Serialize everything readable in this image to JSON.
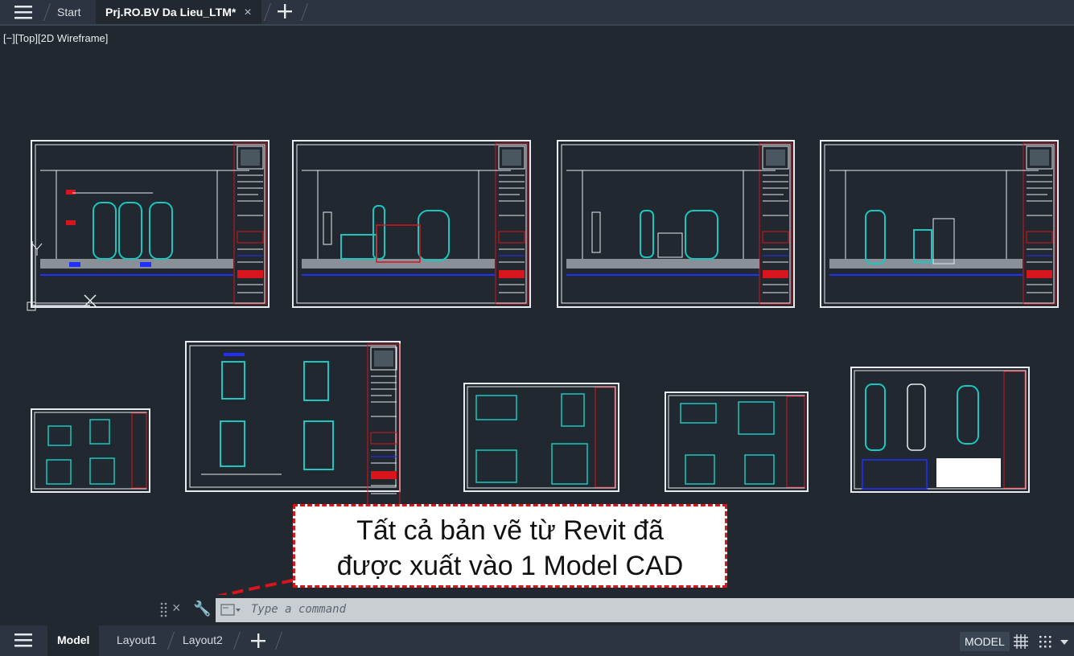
{
  "tabs": [
    {
      "label": "Start",
      "close": ""
    },
    {
      "label": "Prj.RO.BV Da Lieu_LTM*",
      "close": "×"
    }
  ],
  "viewport_label": "[−][Top][2D Wireframe]",
  "callout": {
    "line1": "Tất cả bản vẽ từ Revit đã",
    "line2": "được xuất vào 1 Model CAD"
  },
  "command": {
    "close_glyph": "×",
    "wrench_glyph": "🔧",
    "placeholder": "Type a command"
  },
  "layout_tabs": [
    "Model",
    "Layout1",
    "Layout2"
  ],
  "status": {
    "model_label": "MODEL"
  },
  "icons": [
    "menu-icon",
    "close-icon",
    "plus-icon",
    "ucs-icon",
    "grip-icon",
    "wrench-icon",
    "command-prompt-icon",
    "grid-icon",
    "snap-icon",
    "chevron-down-icon"
  ],
  "colors": {
    "canvas": "#212830",
    "sheet_border": "#e8ecf0",
    "frame_red": "#d8141c",
    "equip_cyan": "#19c7c0",
    "blue": "#2130ff"
  }
}
